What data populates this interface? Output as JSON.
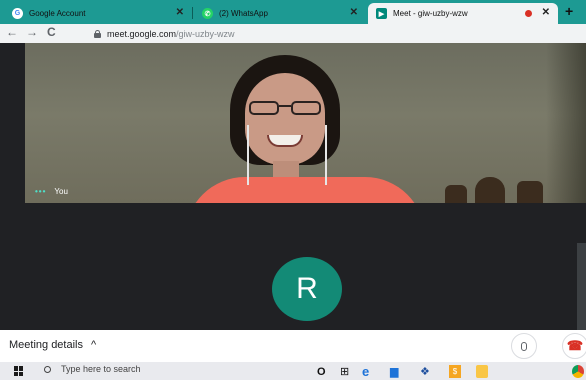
{
  "browser": {
    "tabs": [
      {
        "label": "Google Account",
        "favicon": "G",
        "favicon_color": "#4285f4",
        "active": false
      },
      {
        "label": "(2) WhatsApp",
        "favicon": "",
        "favicon_color": "#25d366",
        "active": false
      },
      {
        "label": "Meet - giw-uzby-wzw",
        "favicon": "",
        "favicon_color": "#00897b",
        "active": true
      }
    ],
    "new_tab": "+",
    "url_host": "meet.google.com",
    "url_path": "/giw-uzby-wzw"
  },
  "meet": {
    "self_label": "You",
    "self_dots": "•••",
    "participant_initial": "R",
    "avatar_color": "#138a76",
    "meeting_details_label": "Meeting details",
    "meeting_details_caret": "^"
  },
  "taskbar": {
    "search_placeholder": "Type here to search",
    "icons": [
      "cortana-icon",
      "task-view-icon",
      "edge-icon",
      "store-icon",
      "dropbox-icon",
      "app-icon",
      "file-explorer-icon",
      "chrome-icon"
    ]
  }
}
